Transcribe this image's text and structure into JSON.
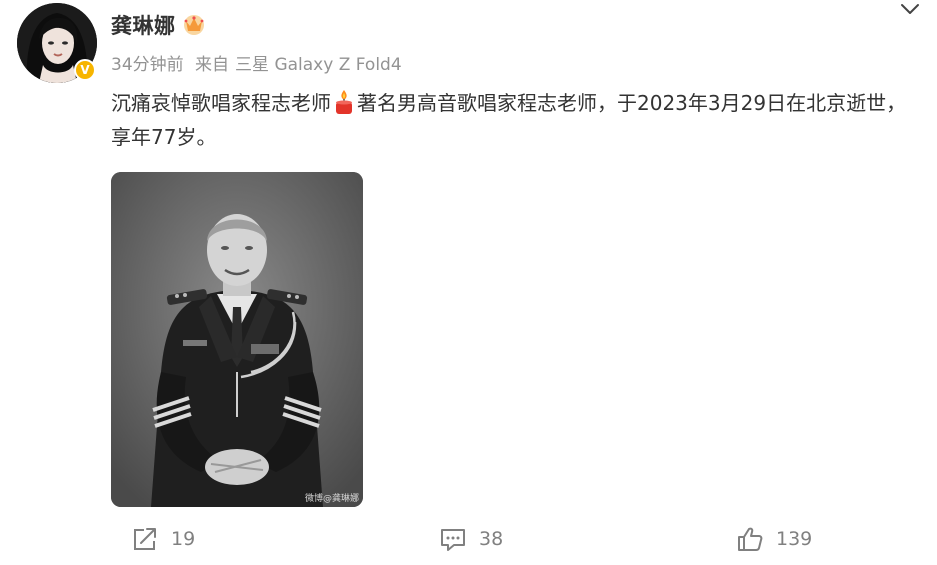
{
  "post": {
    "username": "龚琳娜",
    "time": "34分钟前",
    "source_prefix": "来自",
    "source_device": "三星 Galaxy Z Fold4",
    "text_part1": "沉痛哀悼歌唱家程志老师",
    "text_part2": "著名男高音歌唱家程志老师，于2023年3月29日在北京逝世，享年77岁。",
    "image_watermark": "微博@龚琳娜",
    "actions": {
      "forward_count": "19",
      "comment_count": "38",
      "like_count": "139"
    }
  },
  "icons": {
    "more": "chevron-down-icon",
    "verified": "verified-badge-icon",
    "vip": "crown-icon",
    "candle": "candle-emoji-icon",
    "forward": "forward-icon",
    "comment": "comment-icon",
    "like": "thumbs-up-icon"
  },
  "colors": {
    "text": "#333333",
    "meta": "#939393",
    "action": "#808080",
    "verified": "#f7b500"
  }
}
